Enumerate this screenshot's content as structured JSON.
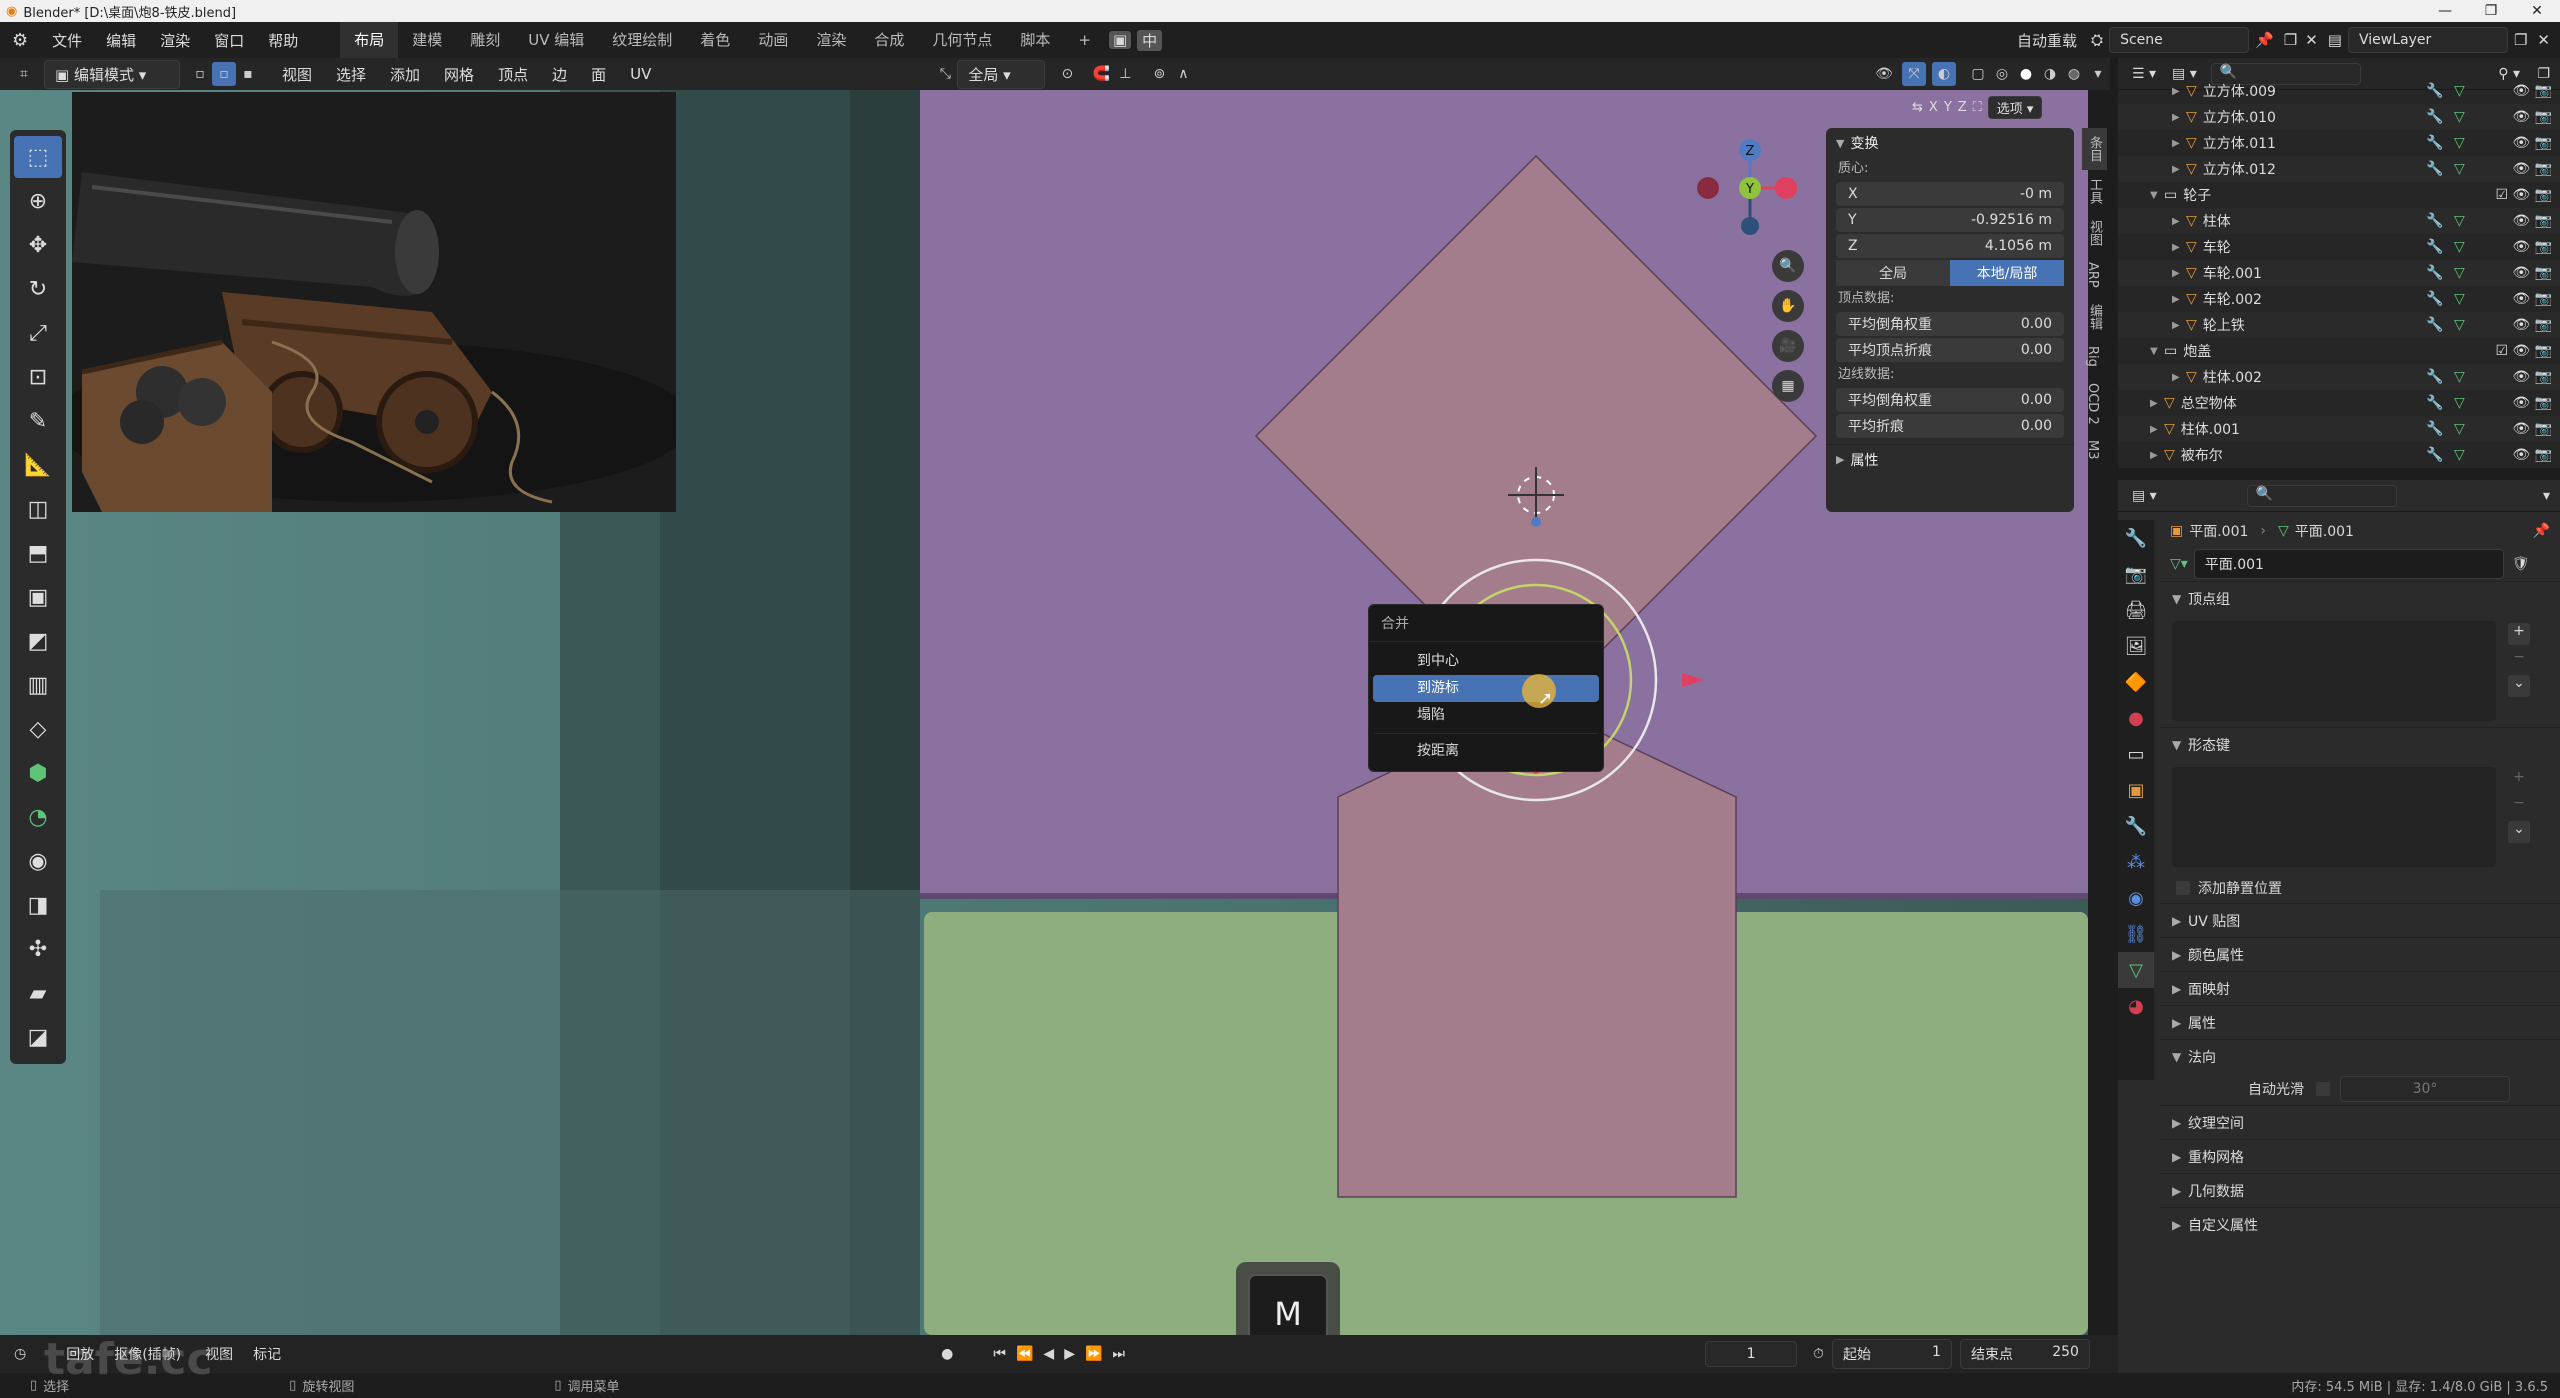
{
  "window": {
    "title": "Blender* [D:\\桌面\\炮8-铁皮.blend]",
    "controls": [
      "—",
      "❐",
      "✕"
    ]
  },
  "menubar": {
    "menus": [
      "文件",
      "编辑",
      "渲染",
      "窗口",
      "帮助"
    ],
    "workspaces": [
      "布局",
      "建模",
      "雕刻",
      "UV 编辑",
      "纹理绘制",
      "着色",
      "动画",
      "渲染",
      "合成",
      "几何节点",
      "脚本"
    ],
    "active_workspace": "布局",
    "lang_button": "中",
    "autosave": "自动重载",
    "scene": "Scene",
    "viewlayer": "ViewLayer"
  },
  "viewport_header": {
    "mode": "编辑模式",
    "menus": [
      "视图",
      "选择",
      "添加",
      "网格",
      "顶点",
      "边",
      "面",
      "UV"
    ],
    "transform_orientation": "全局",
    "axes": [
      "X",
      "Y",
      "Z"
    ],
    "options": "选项"
  },
  "npanel": {
    "transform_title": "变换",
    "median_label": "质心:",
    "x_label": "X",
    "x_value": "-0 m",
    "y_label": "Y",
    "y_value": "-0.92516 m",
    "z_label": "Z",
    "z_value": "4.1056 m",
    "global": "全局",
    "local": "本地/局部",
    "vertex_data": "顶点数据:",
    "mean_bevel_weight": "平均倒角权重",
    "mean_bevel_weight_value": "0.00",
    "mean_vertex_crease": "平均顶点折痕",
    "mean_vertex_crease_value": "0.00",
    "edge_data": "边线数据:",
    "edge_bevel_weight": "平均倒角权重",
    "edge_bevel_weight_value": "0.00",
    "mean_crease": "平均折痕",
    "mean_crease_value": "0.00",
    "attributes": "属性",
    "tabs": [
      "条目",
      "工具",
      "视图",
      "ARP",
      "编辑",
      "Rig",
      "OCD 2",
      "M3"
    ]
  },
  "merge_menu": {
    "title": "合并",
    "items": [
      "到中心",
      "到游标",
      "塌陷",
      "按距离"
    ],
    "highlighted": "到游标"
  },
  "gizmo": {
    "z": "Z",
    "y": "Y"
  },
  "key_overlay": "M",
  "timeline": {
    "menus": [
      "回放",
      "抠像(插帧)",
      "视图",
      "标记"
    ],
    "current_frame": "1",
    "start_label": "起始",
    "start": "1",
    "end_label": "结束点",
    "end": "250"
  },
  "statusbar": {
    "select": "选择",
    "rotate": "旋转视图",
    "menu": "调用菜单",
    "stats": "内存: 54.5 MiB | 显存: 1.4/8.0 GiB | 3.6.5"
  },
  "outliner": {
    "rows": [
      {
        "name": "立方体.009",
        "indent": 2
      },
      {
        "name": "立方体.010",
        "indent": 2
      },
      {
        "name": "立方体.011",
        "indent": 2
      },
      {
        "name": "立方体.012",
        "indent": 2
      },
      {
        "name": "轮子",
        "indent": 1,
        "collection": true
      },
      {
        "name": "柱体",
        "indent": 2
      },
      {
        "name": "车轮",
        "indent": 2
      },
      {
        "name": "车轮.001",
        "indent": 2
      },
      {
        "name": "车轮.002",
        "indent": 2
      },
      {
        "name": "轮上铁",
        "indent": 2
      },
      {
        "name": "炮盖",
        "indent": 1,
        "collection": true
      },
      {
        "name": "柱体.002",
        "indent": 2
      },
      {
        "name": "总空物体",
        "indent": 1
      },
      {
        "name": "柱体.001",
        "indent": 1
      },
      {
        "name": "被布尔",
        "indent": 1
      }
    ]
  },
  "properties": {
    "breadcrumb_obj": "平面.001",
    "breadcrumb_mesh": "平面.001",
    "mesh_name": "平面.001",
    "sections": {
      "vertex_groups": "顶点组",
      "shape_keys": "形态键",
      "add_rest_position": "添加静置位置",
      "uv_maps": "UV 贴图",
      "color_attributes": "颜色属性",
      "face_maps": "面映射",
      "attributes": "属性",
      "normals": "法向",
      "auto_smooth": "自动光滑",
      "auto_smooth_angle": "30°",
      "texture_space": "纹理空间",
      "remesh": "重构网格",
      "geometry_data": "几何数据",
      "custom_props": "自定义属性"
    }
  },
  "watermark": "tafe.cc",
  "colors": {
    "accent": "#4772b3",
    "pink_face": "#a47d8c",
    "purple_bg": "#8b71a0",
    "green_bg": "#8fae7f"
  }
}
